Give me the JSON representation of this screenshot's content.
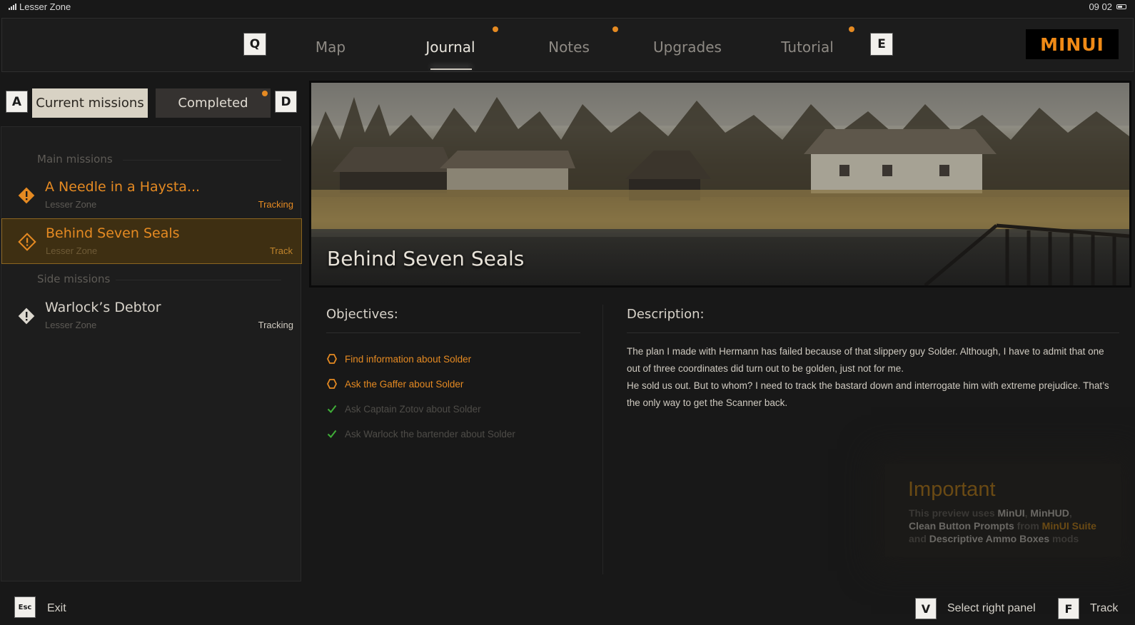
{
  "status_bar": {
    "zone": "Lesser Zone",
    "time": "09 02"
  },
  "nav": {
    "prev_key": "Q",
    "next_key": "E",
    "tabs": [
      {
        "label": "Map",
        "active": false,
        "notification": false
      },
      {
        "label": "Journal",
        "active": true,
        "notification": true
      },
      {
        "label": "Notes",
        "active": false,
        "notification": true
      },
      {
        "label": "Upgrades",
        "active": false,
        "notification": true
      },
      {
        "label": "Tutorial",
        "active": false,
        "notification": false
      }
    ],
    "logo": "MINUI"
  },
  "mission_tabs": {
    "prev_key": "A",
    "next_key": "D",
    "current_label": "Current missions",
    "completed_label": "Completed"
  },
  "missions": {
    "main_header": "Main missions",
    "side_header": "Side missions",
    "items": [
      {
        "title": "A Needle in a Haysta...",
        "zone": "Lesser Zone",
        "status": "Tracking",
        "group": "main"
      },
      {
        "title": "Behind Seven Seals",
        "zone": "Lesser Zone",
        "status": "Track",
        "group": "main"
      },
      {
        "title": "Warlock’s Debtor",
        "zone": "Lesser Zone",
        "status": "Tracking",
        "group": "side"
      }
    ]
  },
  "detail": {
    "title": "Behind Seven Seals",
    "objectives_header": "Objectives:",
    "description_header": "Description:",
    "objectives": [
      {
        "text": "Find information about Solder",
        "state": "active"
      },
      {
        "text": "Ask the Gaffer about Solder",
        "state": "active"
      },
      {
        "text": "Ask Captain Zotov about Solder",
        "state": "done"
      },
      {
        "text": "Ask Warlock the bartender about Solder",
        "state": "done"
      }
    ],
    "description": [
      "The plan I made with Hermann has failed because of that slippery guy Solder. Although, I have to admit that one out of three coordinates did turn out to be golden, just not for me.",
      "He sold us out. But to whom? I need to track the bastard down and interrogate him with extreme prejudice. That’s the only way to get the Scanner back."
    ]
  },
  "important": {
    "title": "Important",
    "t1": "This preview uses ",
    "h1": "MinUI",
    "t2": ", ",
    "h2": "MinHUD",
    "t3": ",",
    "h3": "Clean Button Prompts",
    "t4": " from ",
    "h4": "MinUI Suite",
    "t5": "and ",
    "h5": "Descriptive Ammo Boxes",
    "t6": " mods"
  },
  "footer": {
    "exit_key": "Esc",
    "exit_label": "Exit",
    "select_key": "V",
    "select_label": "Select right panel",
    "track_key": "F",
    "track_label": "Track"
  },
  "colors": {
    "accent": "#e58a22",
    "check": "#3fae38",
    "selected_bg": "#3e2f12"
  }
}
